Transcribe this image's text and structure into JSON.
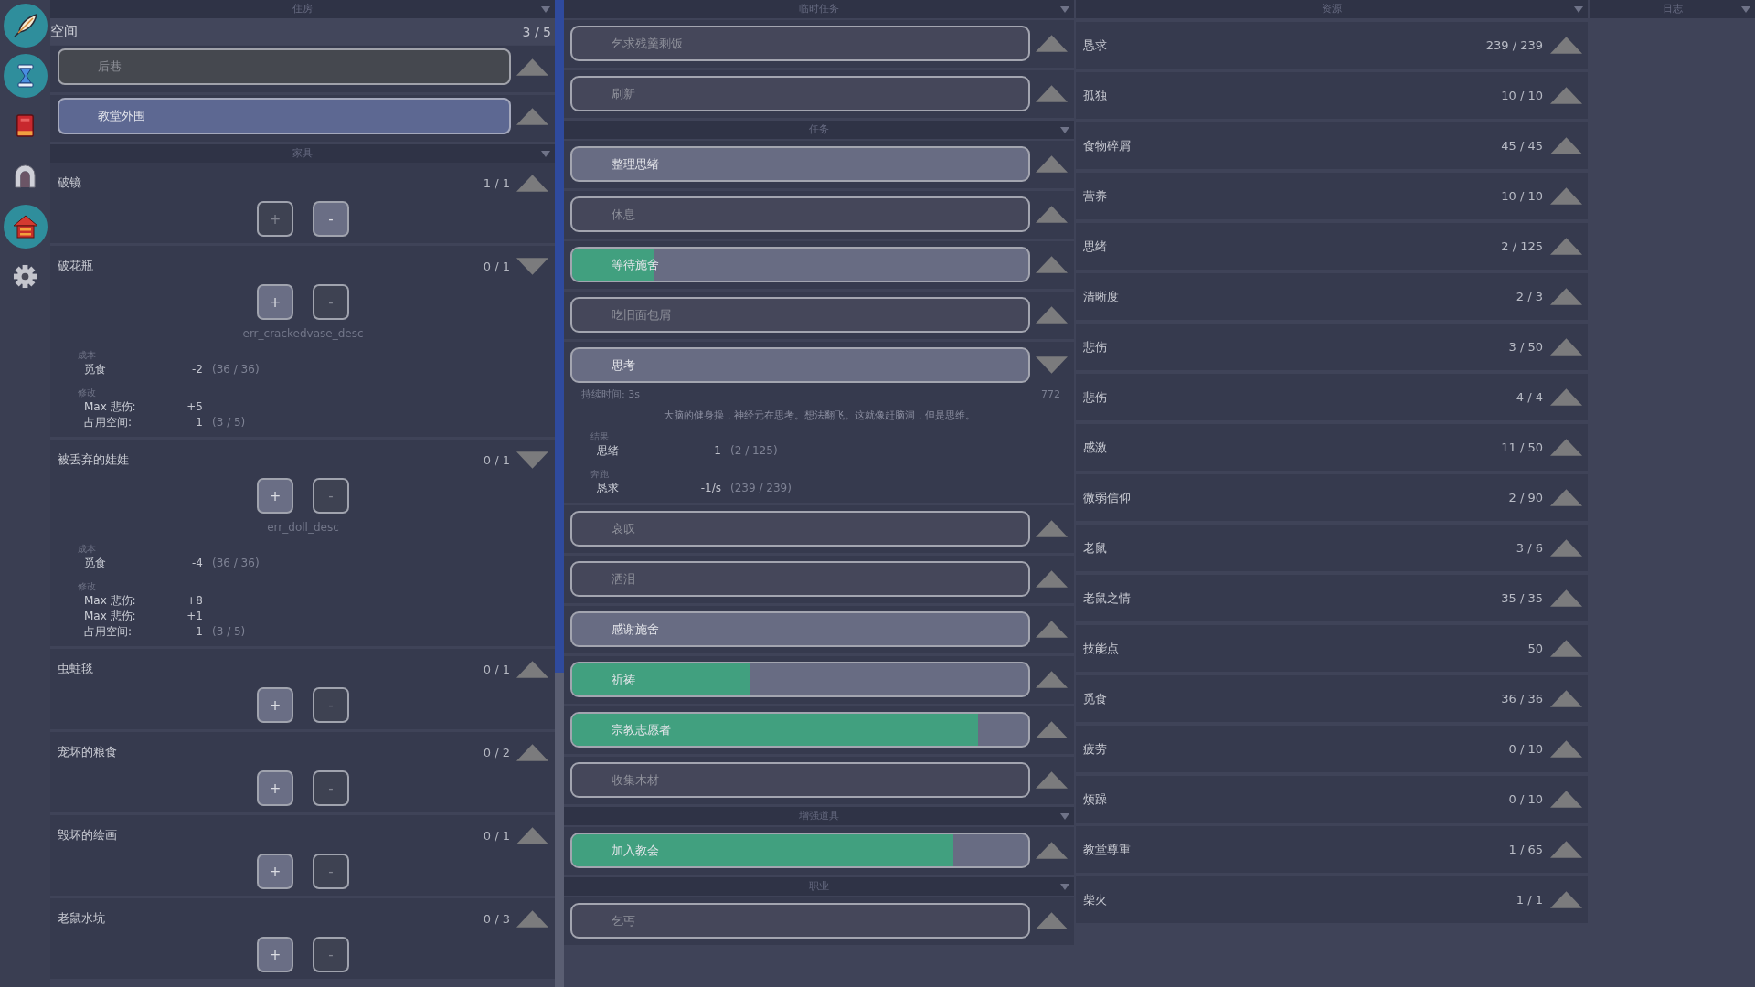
{
  "sidebar": {
    "items": [
      {
        "highlighted": true
      },
      {
        "highlighted": true
      },
      {
        "highlighted": false
      },
      {
        "highlighted": false
      },
      {
        "highlighted": true
      },
      {
        "highlighted": false
      }
    ]
  },
  "housing": {
    "title": "住房",
    "space": {
      "label": "空间",
      "value": "3 / 5"
    },
    "locations": [
      {
        "label": "后巷",
        "selected": false,
        "expanded": false
      },
      {
        "label": "教堂外围",
        "selected": true,
        "expanded": false
      }
    ],
    "furniture_title": "家具",
    "furniture": [
      {
        "name": "破镜",
        "count": "1 / 1",
        "expanded": false,
        "buttons": [
          {
            "label": "+",
            "disabled": true
          },
          {
            "label": "-",
            "disabled": false
          }
        ]
      },
      {
        "name": "破花瓶",
        "count": "0 / 1",
        "expanded": true,
        "buttons": [
          {
            "label": "+",
            "disabled": false
          },
          {
            "label": "-",
            "disabled": true
          }
        ],
        "description": "err_crackedvase_desc",
        "groups": [
          {
            "label": "成本",
            "rows": [
              {
                "name": "觅食",
                "amount": "-2",
                "total": "(36 / 36)"
              }
            ]
          },
          {
            "label": "修改",
            "rows": [
              {
                "name": "Max 悲伤:",
                "amount": "+5"
              },
              {
                "name": "占用空间:",
                "amount": "1",
                "total": "(3 / 5)"
              }
            ]
          }
        ]
      },
      {
        "name": "被丢弃的娃娃",
        "count": "0 / 1",
        "expanded": true,
        "buttons": [
          {
            "label": "+",
            "disabled": false
          },
          {
            "label": "-",
            "disabled": true
          }
        ],
        "description": "err_doll_desc",
        "groups": [
          {
            "label": "成本",
            "rows": [
              {
                "name": "觅食",
                "amount": "-4",
                "total": "(36 / 36)"
              }
            ]
          },
          {
            "label": "修改",
            "rows": [
              {
                "name": "Max 悲伤:",
                "amount": "+8"
              },
              {
                "name": "Max 悲伤:",
                "amount": "+1"
              },
              {
                "name": "占用空间:",
                "amount": "1",
                "total": "(3 / 5)"
              }
            ]
          }
        ]
      },
      {
        "name": "虫蛀毯",
        "count": "0 / 1",
        "expanded": false,
        "buttons": [
          {
            "label": "+",
            "disabled": false
          },
          {
            "label": "-",
            "disabled": true
          }
        ]
      },
      {
        "name": "宠坏的粮食",
        "count": "0 / 2",
        "expanded": false,
        "buttons": [
          {
            "label": "+",
            "disabled": false
          },
          {
            "label": "-",
            "disabled": true
          }
        ]
      },
      {
        "name": "毁坏的绘画",
        "count": "0 / 1",
        "expanded": false,
        "buttons": [
          {
            "label": "+",
            "disabled": false
          },
          {
            "label": "-",
            "disabled": true
          }
        ]
      },
      {
        "name": "老鼠水坑",
        "count": "0 / 3",
        "expanded": false,
        "buttons": [
          {
            "label": "+",
            "disabled": false
          },
          {
            "label": "-",
            "disabled": true
          }
        ]
      }
    ]
  },
  "tasks": {
    "sections": [
      {
        "title": "临时任务",
        "tasks": [
          {
            "label": "乞求残羹剩饭",
            "disabled": true,
            "expanded": false
          },
          {
            "label": "刷新",
            "disabled": true,
            "expanded": false
          }
        ]
      },
      {
        "title": "任务",
        "tasks": [
          {
            "label": "整理思绪",
            "disabled": false,
            "expanded": false
          },
          {
            "label": "休息",
            "disabled": true,
            "expanded": false
          },
          {
            "label": "等待施舍",
            "disabled": false,
            "expanded": false,
            "level": 0.18
          },
          {
            "label": "吃旧面包屑",
            "disabled": true,
            "expanded": false
          },
          {
            "label": "思考",
            "disabled": false,
            "expanded": true,
            "details": {
              "duration": "持续时间: 3s",
              "value": "772",
              "description": "大脑的健身操，神经元在思考。想法翻飞。这就像赶脑洞，但是思维。",
              "groups": [
                {
                  "label": "结果",
                  "rows": [
                    {
                      "name": "思绪",
                      "amount": "1",
                      "total": "(2 / 125)"
                    }
                  ]
                },
                {
                  "label": "奔跑",
                  "rows": [
                    {
                      "name": "恳求",
                      "amount": "-1/s",
                      "total": "(239 / 239)"
                    }
                  ]
                }
              ]
            }
          },
          {
            "label": "哀叹",
            "disabled": true,
            "expanded": false
          },
          {
            "label": "洒泪",
            "disabled": true,
            "expanded": false
          },
          {
            "label": "感谢施舍",
            "disabled": false,
            "expanded": false
          },
          {
            "label": "祈祷",
            "disabled": false,
            "expanded": false,
            "level": 0.39
          },
          {
            "label": "宗教志愿者",
            "disabled": false,
            "expanded": false,
            "level": 0.89
          },
          {
            "label": "收集木材",
            "disabled": true,
            "expanded": false
          }
        ]
      },
      {
        "title": "增强道具",
        "tasks": [
          {
            "label": "加入教会",
            "disabled": false,
            "expanded": false,
            "level": 0.835
          }
        ]
      },
      {
        "title": "职业",
        "tasks": [
          {
            "label": "乞丐",
            "disabled": true,
            "expanded": false
          }
        ]
      }
    ]
  },
  "resources": {
    "title": "资源",
    "rows": [
      {
        "name": "恳求",
        "value": "239 / 239",
        "expanded": false
      },
      {
        "name": "孤独",
        "value": "10 / 10",
        "expanded": false
      },
      {
        "name": "食物碎屑",
        "value": "45 / 45",
        "expanded": false
      },
      {
        "name": "营养",
        "value": "10 / 10",
        "expanded": false
      },
      {
        "name": "思绪",
        "value": "2 / 125",
        "expanded": false
      },
      {
        "name": "清晰度",
        "value": "2 / 3",
        "expanded": false
      },
      {
        "name": "悲伤",
        "value": "3 / 50",
        "expanded": false
      },
      {
        "name": "悲伤",
        "value": "4 / 4",
        "expanded": false
      },
      {
        "name": "感激",
        "value": "11 / 50",
        "expanded": false
      },
      {
        "name": "微弱信仰",
        "value": "2 / 90",
        "expanded": false
      },
      {
        "name": "老鼠",
        "value": "3 / 6",
        "expanded": false
      },
      {
        "name": "老鼠之情",
        "value": "35 / 35",
        "expanded": false
      },
      {
        "name": "技能点",
        "value": "50",
        "expanded": false
      },
      {
        "name": "觅食",
        "value": "36 / 36",
        "expanded": false
      },
      {
        "name": "疲劳",
        "value": "0 / 10",
        "expanded": false
      },
      {
        "name": "烦躁",
        "value": "0 / 10",
        "expanded": false
      },
      {
        "name": "教堂尊重",
        "value": "1 / 65",
        "expanded": false
      },
      {
        "name": "柴火",
        "value": "1 / 1",
        "expanded": false
      }
    ]
  },
  "log": {
    "title": "日志"
  }
}
